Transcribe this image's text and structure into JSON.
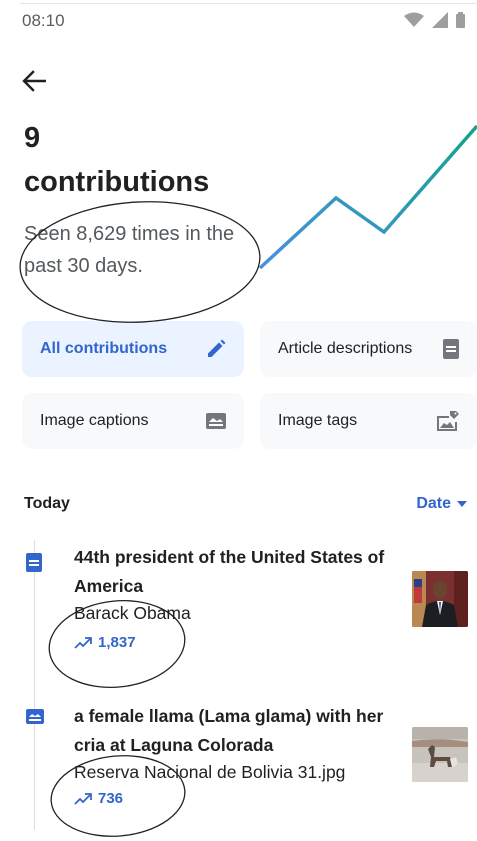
{
  "status_bar": {
    "time": "08:10"
  },
  "summary": {
    "count": "9",
    "count_label": "contributions",
    "seen_text": "Seen 8,629 times in the past 30 days."
  },
  "filters": [
    {
      "label": "All contributions",
      "icon": "pencil-icon"
    },
    {
      "label": "Article descriptions",
      "icon": "document-icon"
    },
    {
      "label": "Image captions",
      "icon": "image-caption-icon"
    },
    {
      "label": "Image tags",
      "icon": "image-tag-icon"
    }
  ],
  "section": {
    "title": "Today",
    "sort_label": "Date"
  },
  "contributions": [
    {
      "title": "44th president of the United States of America",
      "subtitle": "Barack Obama",
      "views": "1,837",
      "type_icon": "document-icon"
    },
    {
      "title": "a female llama (Lama glama) with her cria at Laguna Colorada",
      "subtitle": "Reserva Nacional de Bolivia 31.jpg",
      "views": "736",
      "type_icon": "image-caption-icon"
    }
  ],
  "colors": {
    "accent": "#3366cc",
    "active_chip_bg": "#eaf3ff",
    "chip_bg": "#f8f9fa",
    "graph_start": "#4a90e2",
    "graph_end": "#14a38b"
  }
}
